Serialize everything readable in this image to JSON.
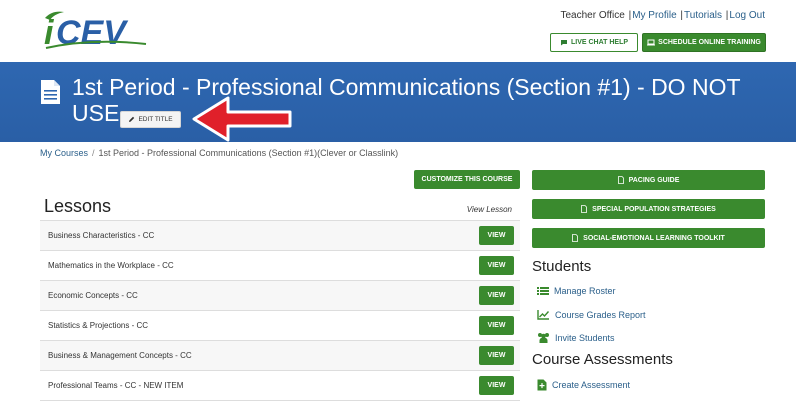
{
  "brand": {
    "logo_text": "iCEV",
    "accent": "#3a8a2e",
    "banner": "#2e67b1",
    "link": "#2a5f8a"
  },
  "toplinks": {
    "teacher_office": "Teacher Office",
    "my_profile": "My Profile",
    "tutorials": "Tutorials",
    "log_out": "Log Out",
    "separator": "|"
  },
  "top_buttons": {
    "live_chat": {
      "icon": "chat-icon",
      "label": "LIVE CHAT HELP"
    },
    "schedule": {
      "icon": "laptop-icon",
      "label": "SCHEDULE ONLINE TRAINING"
    }
  },
  "header": {
    "icon": "document-icon",
    "title": "1st Period - Professional Communications (Section #1) - DO NOT USE",
    "edit_title": {
      "icon": "pencil-icon",
      "label": "EDIT TITLE"
    }
  },
  "breadcrumb": {
    "root": "My Courses",
    "separator": "/",
    "current": "1st Period - Professional Communications (Section #1)(Clever or Classlink)"
  },
  "lessons": {
    "customize_label": "CUSTOMIZE THIS COURSE",
    "heading": "Lessons",
    "view_header": "View Lesson",
    "view_label": "VIEW",
    "items": [
      "Business Characteristics - CC",
      "Mathematics in the Workplace - CC",
      "Economic Concepts - CC",
      "Statistics & Projections - CC",
      "Business & Management Concepts - CC",
      "Professional Teams - CC - NEW ITEM"
    ]
  },
  "resources": {
    "pacing_guide": {
      "icon": "document-icon",
      "label": "PACING GUIDE"
    },
    "special_population": {
      "icon": "document-icon",
      "label": "SPECIAL POPULATION STRATEGIES"
    },
    "sel_toolkit": {
      "icon": "document-icon",
      "label": "SOCIAL-EMOTIONAL LEARNING TOOLKIT"
    }
  },
  "students": {
    "heading": "Students",
    "manage_roster": {
      "icon": "list-icon",
      "label": "Manage Roster"
    },
    "grades_report": {
      "icon": "line-chart-icon",
      "label": "Course Grades Report"
    },
    "invite_students": {
      "icon": "users-icon",
      "label": "Invite Students"
    }
  },
  "assessments": {
    "heading": "Course Assessments",
    "create": {
      "icon": "add-document-icon",
      "label": "Create Assessment"
    }
  }
}
